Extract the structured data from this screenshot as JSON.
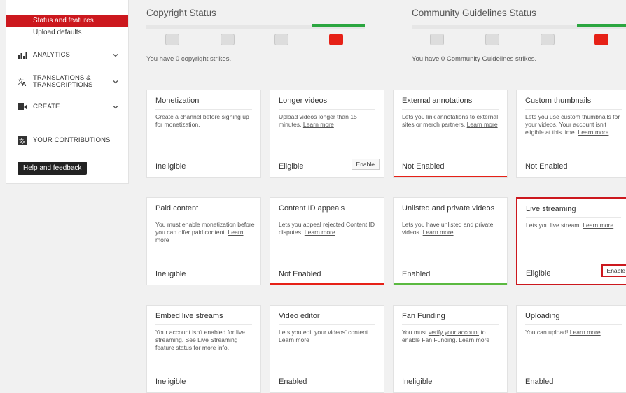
{
  "sidebar": {
    "active_sub": "Status and features",
    "sub_item": "Upload defaults",
    "analytics": "ANALYTICS",
    "translations": "TRANSLATIONS & TRANSCRIPTIONS",
    "create": "CREATE",
    "contributions": "YOUR CONTRIBUTIONS",
    "help": "Help and feedback"
  },
  "copyright": {
    "title": "Copyright Status",
    "text": "You have 0 copyright strikes."
  },
  "community": {
    "title": "Community Guidelines Status",
    "text": "You have 0 Community Guidelines strikes."
  },
  "colors": {
    "accent": "#cc181e",
    "green": "#2ba640",
    "red": "#e62117"
  },
  "cards": [
    {
      "title": "Monetization",
      "pre": "",
      "link1": "Create a channel",
      "mid": " before signing up for monetization.",
      "link2": "",
      "status": "Ineligible",
      "button": "",
      "bar": ""
    },
    {
      "title": "Longer videos",
      "pre": "Upload videos longer than 15 minutes. ",
      "link1": "Learn more",
      "mid": "",
      "link2": "",
      "status": "Eligible",
      "button": "Enable",
      "bar": ""
    },
    {
      "title": "External annotations",
      "pre": "Lets you link annotations to external sites or merch partners. ",
      "link1": "Learn more",
      "mid": "",
      "link2": "",
      "status": "Not Enabled",
      "button": "",
      "bar": "red"
    },
    {
      "title": "Custom thumbnails",
      "pre": "Lets you use custom thumbnails for your videos. Your account isn't eligible at this time. ",
      "link1": "Learn more",
      "mid": "",
      "link2": "",
      "status": "Not Enabled",
      "button": "",
      "bar": ""
    },
    {
      "title": "Paid content",
      "pre": "You must enable monetization before you can offer paid content. ",
      "link1": "Learn more",
      "mid": "",
      "link2": "",
      "status": "Ineligible",
      "button": "",
      "bar": ""
    },
    {
      "title": "Content ID appeals",
      "pre": "Lets you appeal rejected Content ID disputes. ",
      "link1": "Learn more",
      "mid": "",
      "link2": "",
      "status": "Not Enabled",
      "button": "",
      "bar": "red"
    },
    {
      "title": "Unlisted and private videos",
      "pre": "Lets you have unlisted and private videos. ",
      "link1": "Learn more",
      "mid": "",
      "link2": "",
      "status": "Enabled",
      "button": "",
      "bar": "green"
    },
    {
      "title": "Live streaming",
      "pre": "Lets you live stream. ",
      "link1": "Learn more",
      "mid": "",
      "link2": "",
      "status": "Eligible",
      "button": "Enable",
      "bar": "",
      "highlight": true
    },
    {
      "title": "Embed live streams",
      "pre": "Your account isn't enabled for live streaming. See Live Streaming feature status for more info.",
      "link1": "",
      "mid": "",
      "link2": "",
      "status": "Ineligible",
      "button": "",
      "bar": ""
    },
    {
      "title": "Video editor",
      "pre": "Lets you edit your videos' content. ",
      "link1": "Learn more",
      "mid": "",
      "link2": "",
      "status": "Enabled",
      "button": "",
      "bar": ""
    },
    {
      "title": "Fan Funding",
      "pre": "You must ",
      "link1": "verify your account",
      "mid": " to enable Fan Funding. ",
      "link2": "Learn more",
      "status": "Ineligible",
      "button": "",
      "bar": ""
    },
    {
      "title": "Uploading",
      "pre": "You can upload! ",
      "link1": "Learn more",
      "mid": "",
      "link2": "",
      "status": "Enabled",
      "button": "",
      "bar": ""
    }
  ]
}
